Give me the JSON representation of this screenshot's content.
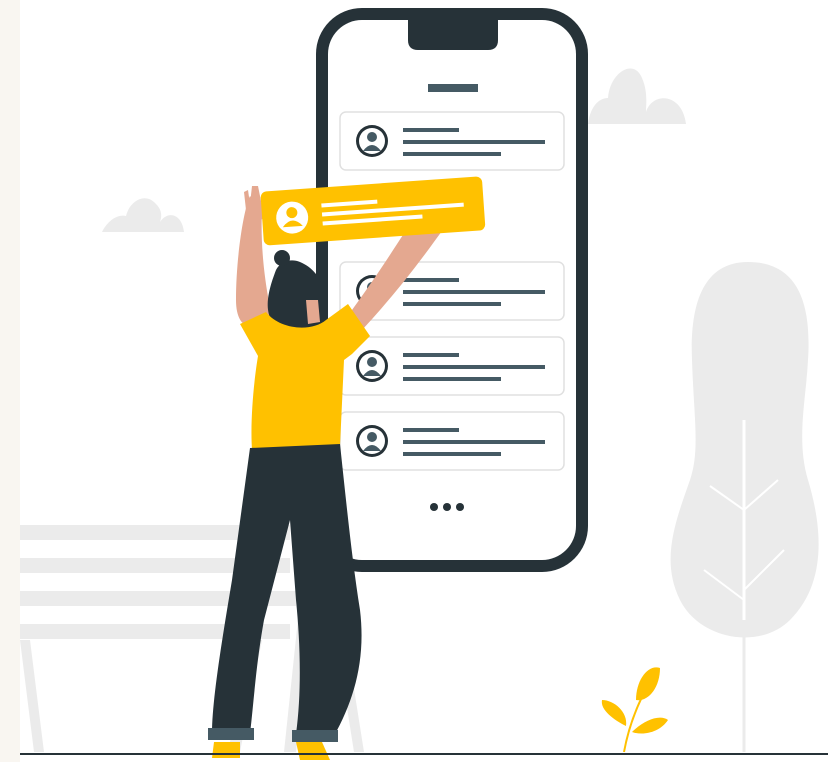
{
  "illustration": {
    "theme": "person rearranging contact cards on a smartphone",
    "colors": {
      "background": "#ffffff",
      "left_strip": "#f9f6f1",
      "phone_frame": "#263238",
      "screen": "#ffffff",
      "card_border": "#e0e0e0",
      "accent": "#ffc100",
      "dark": "#455a64",
      "scenery": "#ebebeb",
      "skin": "#e4a890",
      "hair": "#263238",
      "ground_line": "#263238"
    },
    "phone": {
      "list_items": [
        {
          "avatar": "user-avatar-icon",
          "lines": 3
        },
        {
          "avatar": "user-avatar-icon",
          "lines": 3
        },
        {
          "avatar": "user-avatar-icon",
          "lines": 3
        },
        {
          "avatar": "user-avatar-icon",
          "lines": 3
        }
      ],
      "more_indicator": "more-dots-icon"
    },
    "dragged_card": {
      "avatar": "user-avatar-icon",
      "lines": 3
    },
    "background_elements": [
      "cloud",
      "cloud",
      "tree",
      "bench",
      "plant"
    ]
  }
}
